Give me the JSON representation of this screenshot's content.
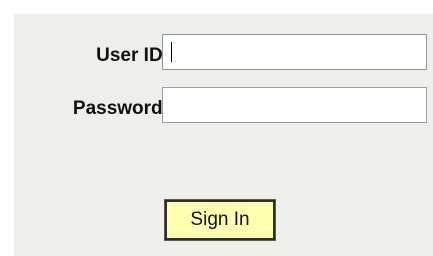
{
  "form": {
    "userid_label": "User ID:",
    "userid_value": "",
    "password_label": "Password:",
    "password_value": "",
    "signin_label": "Sign In"
  },
  "colors": {
    "panel_background": "#eeeeea",
    "signin_background": "#ffffb0"
  }
}
